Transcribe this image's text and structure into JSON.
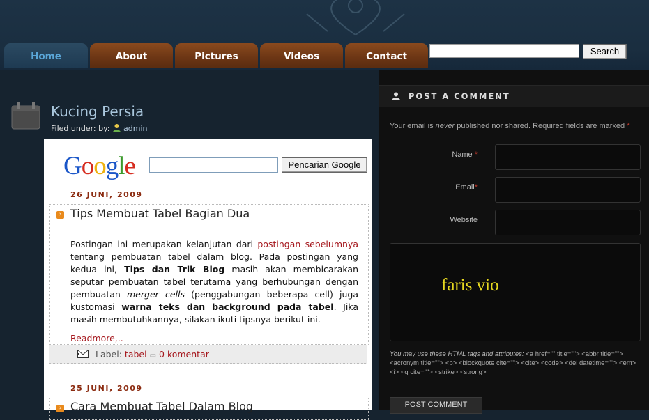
{
  "nav": {
    "tabs": [
      {
        "label": "Home"
      },
      {
        "label": "About"
      },
      {
        "label": "Pictures"
      },
      {
        "label": "Videos"
      },
      {
        "label": "Contact"
      }
    ],
    "search_button": "Search",
    "search_value": ""
  },
  "post": {
    "title": "Kucing Persia",
    "filed_label": "Filed under: by:",
    "author": "admin"
  },
  "google": {
    "logo": "Google",
    "button": "Pencarian Google",
    "value": ""
  },
  "entries": [
    {
      "date": "26 JUNI, 2009",
      "title": "Tips Membuat Tabel Bagian Dua",
      "body": {
        "p1": "Postingan ini merupakan kelanjutan dari ",
        "link": "postingan sebelumnya",
        "p2": " tentang pembuatan tabel dalam blog. Pada postingan yang kedua ini, ",
        "b1": "Tips dan Trik Blog",
        "p3": " masih akan membicarakan seputar pembuatan tabel terutama yang berhubungan dengan pembuatan ",
        "i1": "merger cells",
        "p4": " (penggabungan beberapa cell) juga kustomasi ",
        "b2": "warna teks dan background pada tabel",
        "p5": ". Jika masih membutuhkannya, silakan ikuti tipsnya berikut ini."
      },
      "readmore": "Readmore,..",
      "label_prefix": "Label:",
      "label": "tabel",
      "comments": "0 komentar"
    },
    {
      "date": "25 JUNI, 2009",
      "title": "Cara Membuat Tabel Dalam Blog"
    }
  ],
  "comment_form": {
    "heading": "POST A COMMENT",
    "note_a": "Your email is ",
    "note_never": "never",
    "note_b": " published nor shared. Required fields are marked ",
    "required_mark": "*",
    "name_label": "Name",
    "email_label": "Email",
    "website_label": "Website",
    "comment_value": "faris vio",
    "tags_intro": "You may use these HTML tags and attributes:",
    "tags_list": " <a href=\"\" title=\"\"> <abbr title=\"\"> <acronym title=\"\"> <b> <blockquote cite=\"\"> <cite> <code> <del datetime=\"\"> <em> <i> <q cite=\"\"> <strike> <strong>",
    "submit": "POST COMMENT"
  },
  "colors": {
    "accent_blue": "#5aa6d8",
    "tab_brown": "#6b3514",
    "link_red": "#a5161c",
    "comment_yellow": "#e6d820"
  }
}
